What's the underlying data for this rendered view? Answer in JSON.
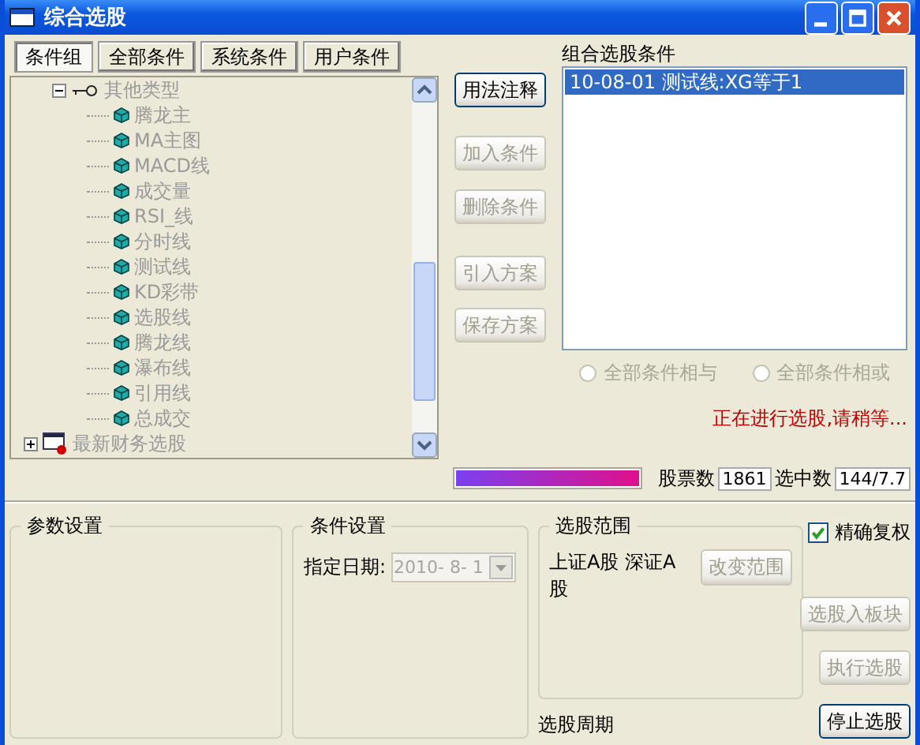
{
  "window": {
    "title": "综合选股"
  },
  "tabs": [
    {
      "label": "条件组",
      "selected": true
    },
    {
      "label": "全部条件",
      "selected": false
    },
    {
      "label": "系统条件",
      "selected": false
    },
    {
      "label": "用户条件",
      "selected": false
    }
  ],
  "tree": [
    {
      "label": "其他类型",
      "kind": "folder",
      "expanded": true,
      "children": [
        {
          "label": "腾龙主",
          "kind": "formula"
        },
        {
          "label": "MA主图",
          "kind": "formula"
        },
        {
          "label": "MACD线",
          "kind": "formula"
        },
        {
          "label": "成交量",
          "kind": "formula"
        },
        {
          "label": "RSI_线",
          "kind": "formula"
        },
        {
          "label": "分时线",
          "kind": "formula"
        },
        {
          "label": "测试线",
          "kind": "formula"
        },
        {
          "label": "KD彩带",
          "kind": "formula"
        },
        {
          "label": "选股线",
          "kind": "formula"
        },
        {
          "label": "腾龙线",
          "kind": "formula"
        },
        {
          "label": "瀑布线",
          "kind": "formula"
        },
        {
          "label": "引用线",
          "kind": "formula"
        },
        {
          "label": "总成交",
          "kind": "formula"
        }
      ]
    },
    {
      "label": "最新财务选股",
      "kind": "finance",
      "expanded": false
    }
  ],
  "side_buttons": [
    {
      "label": "用法注释",
      "disabled": false
    },
    {
      "label": "加入条件",
      "disabled": true
    },
    {
      "label": "删除条件",
      "disabled": true
    },
    {
      "label": "引入方案",
      "disabled": true
    },
    {
      "label": "保存方案",
      "disabled": true
    }
  ],
  "conditions": {
    "title": "组合选股条件",
    "items": [
      {
        "text": "10-08-01 测试线:XG等于1",
        "selected": true
      }
    ]
  },
  "radios": [
    {
      "label": "全部条件相与",
      "selected": false,
      "disabled": true
    },
    {
      "label": "全部条件相或",
      "selected": false,
      "disabled": true
    }
  ],
  "status": "正在进行选股,请稍等...",
  "progress": {
    "level": 1
  },
  "stock_count": {
    "label": "股票数",
    "value": "1861"
  },
  "selected_count": {
    "label": "选中数",
    "value": "144/7.7"
  },
  "param_group": {
    "title": "参数设置"
  },
  "condition_group": {
    "title": "条件设置",
    "date_label": "指定日期:",
    "date_value": "2010- 8- 1",
    "disabled": true
  },
  "scope_group": {
    "title": "选股范围",
    "scope": "上证A股 深证A股",
    "button": {
      "label": "改变范围",
      "disabled": true
    }
  },
  "period_label": "选股周期",
  "exact_adjust": {
    "label": "精确复权",
    "checked": true
  },
  "action_buttons": [
    {
      "label": "选股入板块",
      "disabled": true
    },
    {
      "label": "执行选股",
      "disabled": true
    },
    {
      "label": "停止选股",
      "disabled": false
    }
  ]
}
